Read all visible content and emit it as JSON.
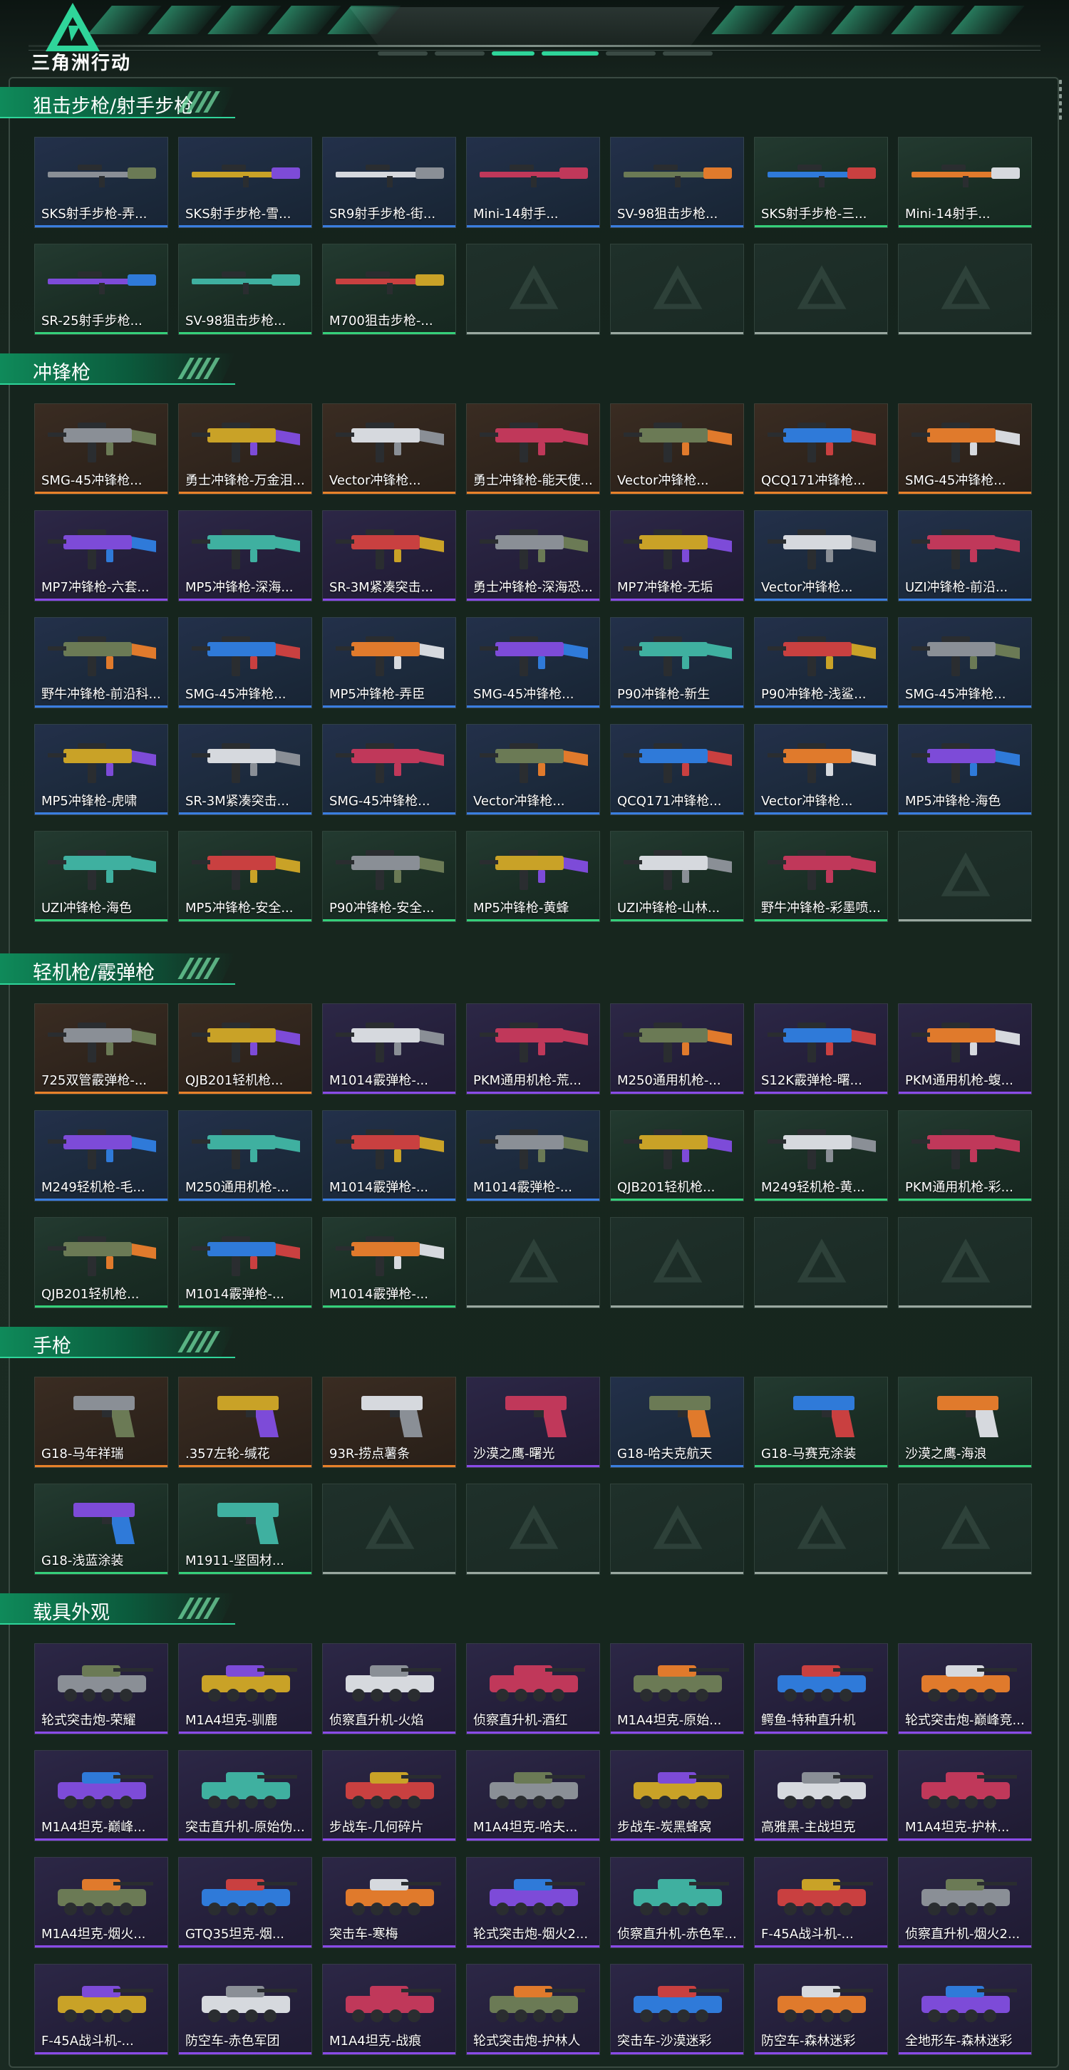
{
  "app": {
    "brand": "三角洲行动"
  },
  "colors": {
    "green": "#35d07a",
    "blue": "#3a7ee0",
    "purple": "#8a4be8",
    "orange": "#e8822a",
    "empty": "#9aa8a0",
    "accent": "#2fd59a"
  },
  "sections": [
    {
      "title": "狙击步枪/射手步枪",
      "kind": "rifle",
      "items": [
        {
          "name": "SKS射手步枪-弄...",
          "rarity": "blue"
        },
        {
          "name": "SKS射手步枪-雪...",
          "rarity": "blue"
        },
        {
          "name": "SR9射手步枪-街...",
          "rarity": "blue"
        },
        {
          "name": "Mini-14射手...",
          "rarity": "blue"
        },
        {
          "name": "SV-98狙击步枪...",
          "rarity": "blue"
        },
        {
          "name": "SKS射手步枪-三...",
          "rarity": "green"
        },
        {
          "name": "Mini-14射手...",
          "rarity": "green"
        },
        {
          "name": "SR-25射手步枪...",
          "rarity": "green"
        },
        {
          "name": "SV-98狙击步枪...",
          "rarity": "green"
        },
        {
          "name": "M700狙击步枪-...",
          "rarity": "green"
        },
        {
          "name": "",
          "rarity": "empty"
        },
        {
          "name": "",
          "rarity": "empty"
        },
        {
          "name": "",
          "rarity": "empty"
        },
        {
          "name": "",
          "rarity": "empty"
        }
      ]
    },
    {
      "title": "冲锋枪",
      "kind": "smg",
      "items": [
        {
          "name": "SMG-45冲锋枪...",
          "rarity": "orange"
        },
        {
          "name": "勇士冲锋枪-万金泪...",
          "rarity": "orange"
        },
        {
          "name": "Vector冲锋枪...",
          "rarity": "orange"
        },
        {
          "name": "勇士冲锋枪-能天使...",
          "rarity": "orange"
        },
        {
          "name": "Vector冲锋枪...",
          "rarity": "orange"
        },
        {
          "name": "QCQ171冲锋枪...",
          "rarity": "orange"
        },
        {
          "name": "SMG-45冲锋枪...",
          "rarity": "orange"
        },
        {
          "name": "MP7冲锋枪-六套...",
          "rarity": "purple"
        },
        {
          "name": "MP5冲锋枪-深海...",
          "rarity": "purple"
        },
        {
          "name": "SR-3M紧凑突击...",
          "rarity": "purple"
        },
        {
          "name": "勇士冲锋枪-深海恐...",
          "rarity": "purple"
        },
        {
          "name": "MP7冲锋枪-无垢",
          "rarity": "purple"
        },
        {
          "name": "Vector冲锋枪...",
          "rarity": "blue"
        },
        {
          "name": "UZI冲锋枪-前沿...",
          "rarity": "blue"
        },
        {
          "name": "野牛冲锋枪-前沿科...",
          "rarity": "blue"
        },
        {
          "name": "SMG-45冲锋枪...",
          "rarity": "blue"
        },
        {
          "name": "MP5冲锋枪-弄臣",
          "rarity": "blue"
        },
        {
          "name": "SMG-45冲锋枪...",
          "rarity": "blue"
        },
        {
          "name": "P90冲锋枪-新生",
          "rarity": "blue"
        },
        {
          "name": "P90冲锋枪-浅鲨...",
          "rarity": "blue"
        },
        {
          "name": "SMG-45冲锋枪...",
          "rarity": "blue"
        },
        {
          "name": "MP5冲锋枪-虎啸",
          "rarity": "blue"
        },
        {
          "name": "SR-3M紧凑突击...",
          "rarity": "blue"
        },
        {
          "name": "SMG-45冲锋枪...",
          "rarity": "blue"
        },
        {
          "name": "Vector冲锋枪...",
          "rarity": "blue"
        },
        {
          "name": "QCQ171冲锋枪...",
          "rarity": "blue"
        },
        {
          "name": "Vector冲锋枪...",
          "rarity": "blue"
        },
        {
          "name": "MP5冲锋枪-海色",
          "rarity": "blue"
        },
        {
          "name": "UZI冲锋枪-海色",
          "rarity": "green"
        },
        {
          "name": "MP5冲锋枪-安全...",
          "rarity": "green"
        },
        {
          "name": "P90冲锋枪-安全...",
          "rarity": "green"
        },
        {
          "name": "MP5冲锋枪-黄蜂",
          "rarity": "green"
        },
        {
          "name": "UZI冲锋枪-山林...",
          "rarity": "green"
        },
        {
          "name": "野牛冲锋枪-彩墨喷...",
          "rarity": "green"
        },
        {
          "name": "",
          "rarity": "empty"
        }
      ]
    },
    {
      "title": "轻机枪/霰弹枪",
      "kind": "lmg",
      "items": [
        {
          "name": "725双管霰弹枪-...",
          "rarity": "orange"
        },
        {
          "name": "QJB201轻机枪...",
          "rarity": "orange"
        },
        {
          "name": "M1014霰弹枪-...",
          "rarity": "purple"
        },
        {
          "name": "PKM通用机枪-荒...",
          "rarity": "purple"
        },
        {
          "name": "M250通用机枪-...",
          "rarity": "purple"
        },
        {
          "name": "S12K霰弹枪-曙...",
          "rarity": "purple"
        },
        {
          "name": "PKM通用机枪-蝮...",
          "rarity": "purple"
        },
        {
          "name": "M249轻机枪-毛...",
          "rarity": "blue"
        },
        {
          "name": "M250通用机枪-...",
          "rarity": "blue"
        },
        {
          "name": "M1014霰弹枪-...",
          "rarity": "blue"
        },
        {
          "name": "M1014霰弹枪-...",
          "rarity": "blue"
        },
        {
          "name": "QJB201轻机枪...",
          "rarity": "green"
        },
        {
          "name": "M249轻机枪-黄...",
          "rarity": "green"
        },
        {
          "name": "PKM通用机枪-彩...",
          "rarity": "green"
        },
        {
          "name": "QJB201轻机枪...",
          "rarity": "green"
        },
        {
          "name": "M1014霰弹枪-...",
          "rarity": "green"
        },
        {
          "name": "M1014霰弹枪-...",
          "rarity": "green"
        },
        {
          "name": "",
          "rarity": "empty"
        },
        {
          "name": "",
          "rarity": "empty"
        },
        {
          "name": "",
          "rarity": "empty"
        },
        {
          "name": "",
          "rarity": "empty"
        }
      ]
    },
    {
      "title": "手枪",
      "kind": "pistol",
      "items": [
        {
          "name": "G18-马年祥瑞",
          "rarity": "orange"
        },
        {
          "name": ".357左轮-缄花",
          "rarity": "orange"
        },
        {
          "name": "93R-捞点薯条",
          "rarity": "orange"
        },
        {
          "name": "沙漠之鹰-曙光",
          "rarity": "purple"
        },
        {
          "name": "G18-哈夫克航天",
          "rarity": "blue"
        },
        {
          "name": "G18-马赛克涂装",
          "rarity": "green"
        },
        {
          "name": "沙漠之鹰-海浪",
          "rarity": "green"
        },
        {
          "name": "G18-浅蓝涂装",
          "rarity": "green"
        },
        {
          "name": "M1911-坚固材...",
          "rarity": "green"
        },
        {
          "name": "",
          "rarity": "empty"
        },
        {
          "name": "",
          "rarity": "empty"
        },
        {
          "name": "",
          "rarity": "empty"
        },
        {
          "name": "",
          "rarity": "empty"
        },
        {
          "name": "",
          "rarity": "empty"
        }
      ]
    },
    {
      "title": "载具外观",
      "kind": "vehicle",
      "items": [
        {
          "name": "轮式突击炮-荣耀",
          "rarity": "purple"
        },
        {
          "name": "M1A4坦克-驯鹿",
          "rarity": "purple"
        },
        {
          "name": "侦察直升机-火焰",
          "rarity": "purple"
        },
        {
          "name": "侦察直升机-酒红",
          "rarity": "purple"
        },
        {
          "name": "M1A4坦克-原始...",
          "rarity": "purple"
        },
        {
          "name": "鳄鱼-特种直升机",
          "rarity": "purple"
        },
        {
          "name": "轮式突击炮-巅峰竞...",
          "rarity": "purple"
        },
        {
          "name": "M1A4坦克-巅峰...",
          "rarity": "purple"
        },
        {
          "name": "突击直升机-原始伪...",
          "rarity": "purple"
        },
        {
          "name": "步战车-几何碎片",
          "rarity": "purple"
        },
        {
          "name": "M1A4坦克-哈夫...",
          "rarity": "purple"
        },
        {
          "name": "步战车-炭黑蜂窝",
          "rarity": "purple"
        },
        {
          "name": "高雅黑-主战坦克",
          "rarity": "purple"
        },
        {
          "name": "M1A4坦克-护林...",
          "rarity": "purple"
        },
        {
          "name": "M1A4坦克-烟火...",
          "rarity": "purple"
        },
        {
          "name": "GTQ35坦克-烟...",
          "rarity": "purple"
        },
        {
          "name": "突击车-寒梅",
          "rarity": "purple"
        },
        {
          "name": "轮式突击炮-烟火2...",
          "rarity": "purple"
        },
        {
          "name": "侦察直升机-赤色军...",
          "rarity": "purple"
        },
        {
          "name": "F-45A战斗机-...",
          "rarity": "purple"
        },
        {
          "name": "侦察直升机-烟火2...",
          "rarity": "purple"
        },
        {
          "name": "F-45A战斗机-...",
          "rarity": "purple"
        },
        {
          "name": "防空车-赤色军团",
          "rarity": "purple"
        },
        {
          "name": "M1A4坦克-战痕",
          "rarity": "purple"
        },
        {
          "name": "轮式突击炮-护林人",
          "rarity": "purple"
        },
        {
          "name": "突击车-沙漠迷彩",
          "rarity": "purple"
        },
        {
          "name": "防空车-森林迷彩",
          "rarity": "purple"
        },
        {
          "name": "全地形车-森林迷彩",
          "rarity": "purple"
        }
      ]
    }
  ]
}
